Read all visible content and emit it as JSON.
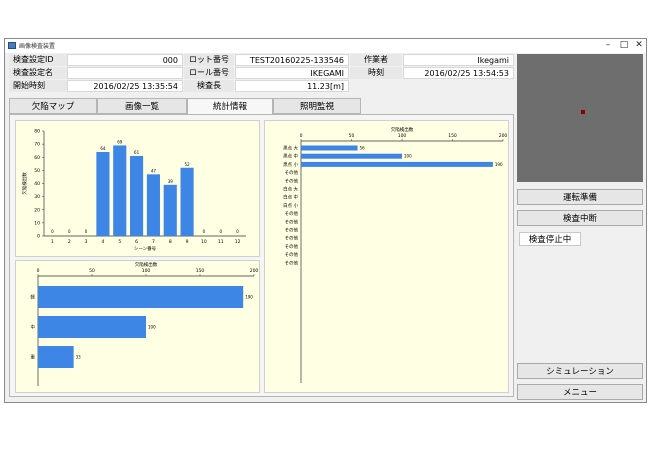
{
  "window": {
    "title": "画像検査装置"
  },
  "info": {
    "inspection_id_label": "検査設定ID",
    "inspection_id": "000",
    "roll_label": "ロット番号",
    "roll": "TEST20160225-133546",
    "worker_label": "作業者",
    "worker": "Ikegami",
    "setting_name_label": "検査設定名",
    "setting_name": "",
    "roll_number_label": "ロール番号",
    "roll_number": "IKEGAMI",
    "time_label": "時刻",
    "time": "2016/02/25 13:54:53",
    "start_label": "開始時刻",
    "start": "2016/02/25 13:35:54",
    "length_label": "検査長",
    "length": "11.23[m]"
  },
  "tabs": [
    "欠陥マップ",
    "画像一覧",
    "統計情報",
    "照明監視"
  ],
  "active_tab": 2,
  "buttons": {
    "run_prep": "運転準備",
    "pause": "検査中断",
    "simulation": "シミュレーション",
    "menu": "メニュー"
  },
  "status": "検査停止中",
  "colors": {
    "bar": "#3d86e6",
    "panel_bg": "#ffffe3"
  },
  "chart_data": [
    {
      "type": "bar",
      "title": "",
      "xlabel": "シーン番号",
      "ylabel": "欠陥検出数",
      "ylim": [
        0,
        80
      ],
      "yticks": [
        0,
        10,
        20,
        30,
        40,
        50,
        60,
        70,
        80
      ],
      "categories": [
        "1",
        "2",
        "3",
        "4",
        "5",
        "6",
        "7",
        "8",
        "9",
        "10",
        "11",
        "12"
      ],
      "values": [
        0,
        0,
        0,
        64,
        69,
        61,
        47,
        39,
        52,
        0,
        0,
        0
      ],
      "labels": [
        "0",
        "0",
        "0",
        "64",
        "69",
        "61",
        "47",
        "39",
        "52",
        "0",
        "0",
        "0"
      ]
    },
    {
      "type": "bar",
      "orientation": "horizontal",
      "title": "欠陥検出数",
      "xlim": [
        0,
        200
      ],
      "xticks": [
        0,
        50,
        100,
        150,
        200
      ],
      "categories": [
        "軽",
        "中",
        "重"
      ],
      "values": [
        190,
        100,
        33
      ],
      "labels": [
        "190",
        "100",
        "33"
      ]
    },
    {
      "type": "bar",
      "orientation": "horizontal",
      "title": "欠陥検出数",
      "xlim": [
        0,
        200
      ],
      "xticks": [
        0,
        50,
        100,
        150,
        200
      ],
      "categories": [
        "黒点 大",
        "黒点 中",
        "黒点 小",
        "その他",
        "その他",
        "白点 大",
        "白点 中",
        "白点 小",
        "その他",
        "その他",
        "その他",
        "その他",
        "その他",
        "その他",
        "その他"
      ],
      "values": [
        56,
        100,
        190,
        0,
        0,
        0,
        0,
        0,
        0,
        0,
        0,
        0,
        0,
        0,
        0
      ],
      "labels": [
        "56",
        "100",
        "190"
      ]
    }
  ]
}
